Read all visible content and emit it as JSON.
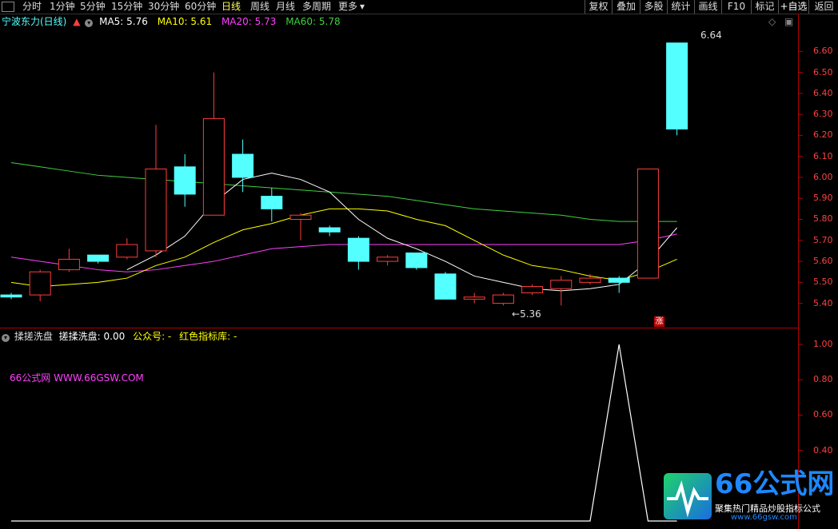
{
  "toolbar": {
    "periods": [
      "分时",
      "1分钟",
      "5分钟",
      "15分钟",
      "30分钟",
      "60分钟",
      "日线",
      "周线",
      "月线",
      "多周期",
      "更多"
    ],
    "active_period": "日线",
    "tools": [
      "复权",
      "叠加",
      "多股",
      "统计",
      "画线",
      "F10",
      "标记",
      "+自选",
      "返回"
    ]
  },
  "main": {
    "stock_name": "宁波东力(日线)",
    "ma": [
      {
        "label": "MA5: 5.76",
        "color": "#ffffff"
      },
      {
        "label": "MA10: 5.61",
        "color": "#ffff00"
      },
      {
        "label": "MA20: 5.73",
        "color": "#ff40ff"
      },
      {
        "label": "MA60: 5.78",
        "color": "#40d040"
      }
    ],
    "high_label": "6.64",
    "low_label": "5.36",
    "zhang_badge": "涨",
    "y_ticks": [
      "6.60",
      "6.50",
      "6.40",
      "6.30",
      "6.20",
      "6.10",
      "6.00",
      "5.90",
      "5.80",
      "5.70",
      "5.60",
      "5.50",
      "5.40"
    ]
  },
  "indicator": {
    "name": "揉搓洗盘",
    "line_label": "搓揉洗盘: 0.00",
    "gzh_label": "公众号: -",
    "lib_label": "红色指标库: -",
    "watermark_site": "66公式网 WWW.66GSW.COM",
    "y_ticks": [
      "1.00",
      "0.80",
      "0.60",
      "0.40"
    ]
  },
  "logo": {
    "brand": "66公式网",
    "slogan": "聚集热门精品炒股指标公式",
    "url": "www.66gsw.com"
  },
  "colors": {
    "up": "#ff3c3c",
    "down": "#54ffff",
    "axis": "#b00000"
  },
  "chart_data": {
    "type": "candlestick",
    "candles": [
      {
        "open": 5.44,
        "close": 5.43,
        "high": 5.45,
        "low": 5.42
      },
      {
        "open": 5.44,
        "close": 5.55,
        "high": 5.56,
        "low": 5.41
      },
      {
        "open": 5.56,
        "close": 5.61,
        "high": 5.66,
        "low": 5.55
      },
      {
        "open": 5.63,
        "close": 5.6,
        "high": 5.63,
        "low": 5.59
      },
      {
        "open": 5.62,
        "close": 5.68,
        "high": 5.71,
        "low": 5.61
      },
      {
        "open": 5.65,
        "close": 6.04,
        "high": 6.25,
        "low": 5.62
      },
      {
        "open": 6.05,
        "close": 5.92,
        "high": 6.11,
        "low": 5.86
      },
      {
        "open": 5.82,
        "close": 6.28,
        "high": 6.5,
        "low": 5.82
      },
      {
        "open": 6.11,
        "close": 6.0,
        "high": 6.18,
        "low": 5.93
      },
      {
        "open": 5.91,
        "close": 5.85,
        "high": 5.95,
        "low": 5.79
      },
      {
        "open": 5.8,
        "close": 5.82,
        "high": 5.83,
        "low": 5.7
      },
      {
        "open": 5.76,
        "close": 5.74,
        "high": 5.77,
        "low": 5.72
      },
      {
        "open": 5.71,
        "close": 5.6,
        "high": 5.72,
        "low": 5.56
      },
      {
        "open": 5.6,
        "close": 5.62,
        "high": 5.63,
        "low": 5.58
      },
      {
        "open": 5.64,
        "close": 5.57,
        "high": 5.64,
        "low": 5.56
      },
      {
        "open": 5.54,
        "close": 5.42,
        "high": 5.55,
        "low": 5.42
      },
      {
        "open": 5.42,
        "close": 5.43,
        "high": 5.45,
        "low": 5.4
      },
      {
        "open": 5.4,
        "close": 5.44,
        "high": 5.45,
        "low": 5.39
      },
      {
        "open": 5.45,
        "close": 5.48,
        "high": 5.49,
        "low": 5.44
      },
      {
        "open": 5.47,
        "close": 5.51,
        "high": 5.53,
        "low": 5.39
      },
      {
        "open": 5.5,
        "close": 5.52,
        "high": 5.54,
        "low": 5.49
      },
      {
        "open": 5.52,
        "close": 5.5,
        "high": 5.53,
        "low": 5.45
      },
      {
        "open": 5.52,
        "close": 6.04,
        "high": 6.04,
        "low": 5.52
      },
      {
        "open": 6.64,
        "close": 6.23,
        "high": 6.64,
        "low": 6.2
      }
    ],
    "ma5": [
      null,
      null,
      null,
      null,
      5.56,
      5.63,
      5.72,
      5.88,
      5.99,
      6.02,
      5.99,
      5.93,
      5.8,
      5.71,
      5.66,
      5.6,
      5.53,
      5.5,
      5.47,
      5.46,
      5.47,
      5.49,
      5.6,
      5.76
    ],
    "ma10": [
      5.5,
      5.48,
      5.49,
      5.5,
      5.52,
      5.58,
      5.62,
      5.69,
      5.75,
      5.78,
      5.82,
      5.85,
      5.85,
      5.84,
      5.8,
      5.77,
      5.7,
      5.63,
      5.58,
      5.56,
      5.53,
      5.51,
      5.55,
      5.61
    ],
    "ma20": [
      5.62,
      5.6,
      5.58,
      5.56,
      5.55,
      5.56,
      5.58,
      5.6,
      5.63,
      5.66,
      5.67,
      5.68,
      5.68,
      5.68,
      5.68,
      5.68,
      5.68,
      5.68,
      5.68,
      5.68,
      5.68,
      5.68,
      5.7,
      5.73
    ],
    "ma60": [
      6.07,
      6.05,
      6.03,
      6.01,
      6.0,
      5.99,
      5.98,
      5.97,
      5.96,
      5.95,
      5.94,
      5.93,
      5.92,
      5.91,
      5.89,
      5.87,
      5.85,
      5.84,
      5.83,
      5.82,
      5.8,
      5.79,
      5.79,
      5.79
    ],
    "indicator": [
      0,
      0,
      0,
      0,
      0,
      0,
      0,
      0,
      0,
      0,
      0,
      0,
      0,
      0,
      0,
      0,
      0,
      0,
      0,
      0,
      0,
      1,
      0,
      0
    ],
    "ylim": [
      5.33,
      6.7
    ],
    "indicator_ylim": [
      0,
      1.05
    ]
  }
}
